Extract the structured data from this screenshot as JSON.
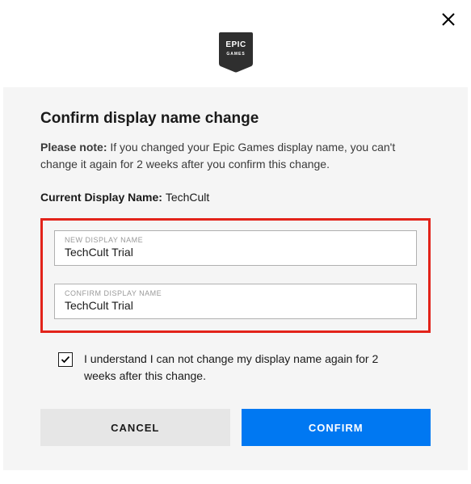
{
  "header": {
    "logo_alt": "Epic Games"
  },
  "dialog": {
    "title": "Confirm display name change",
    "note_bold": "Please note:",
    "note_text": " If you changed your Epic Games display name, you can't change it again for 2 weeks after you confirm this change.",
    "current_label": "Current Display Name: ",
    "current_value": "TechCult",
    "fields": {
      "new_label": "NEW DISPLAY NAME",
      "new_value": "TechCult Trial",
      "confirm_label": "CONFIRM DISPLAY NAME",
      "confirm_value": "TechCult Trial"
    },
    "checkbox_label": "I understand I can not change my display name again for 2 weeks after this change.",
    "checkbox_checked": true,
    "buttons": {
      "cancel": "CANCEL",
      "confirm": "CONFIRM"
    }
  }
}
